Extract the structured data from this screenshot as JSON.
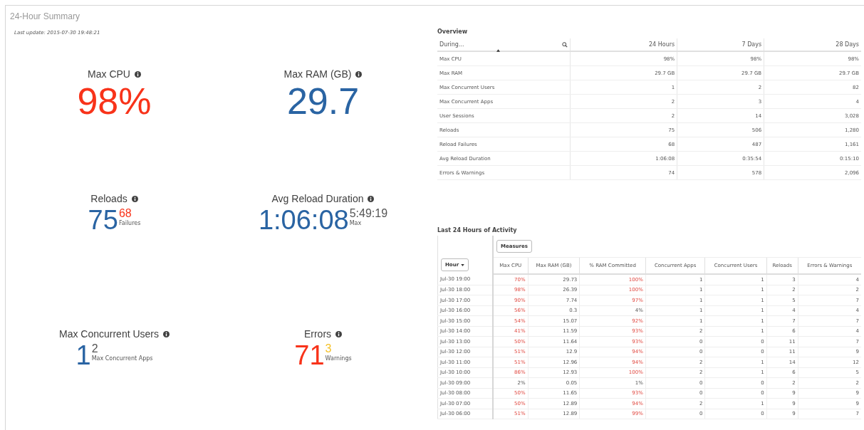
{
  "title": "24-Hour Summary",
  "last_update": "Last update: 2015-07-30 19:48:21",
  "kpis": [
    {
      "label": "Max CPU",
      "value": "98%",
      "color": "#f8331a"
    },
    {
      "label": "Max RAM (GB)",
      "value": "29.7",
      "color": "#2a64a3"
    },
    {
      "label": "Reloads",
      "value": "75",
      "color": "#2a64a3",
      "sub": {
        "value": "68",
        "label": "Failures",
        "color": "#f8331a"
      }
    },
    {
      "label": "Avg Reload Duration",
      "value": "1:06:08",
      "color": "#2a64a3",
      "sub": {
        "value": "5:49:19",
        "label": "Max",
        "color": "#555555"
      }
    },
    {
      "label": "Max Concurrent Users",
      "value": "1",
      "color": "#2a64a3",
      "sub": {
        "value": "2",
        "label": "Max Concurrent Apps",
        "color": "#555555"
      }
    },
    {
      "label": "Errors",
      "value": "71",
      "color": "#f8331a",
      "sub": {
        "value": "3",
        "label": "Warnings",
        "color": "#f5c22a"
      }
    }
  ],
  "overview": {
    "title": "Overview",
    "columns": [
      "During...",
      "24 Hours",
      "7 Days",
      "28 Days"
    ],
    "rows": [
      [
        "Max CPU",
        "98%",
        "98%",
        "98%"
      ],
      [
        "Max RAM",
        "29.7 GB",
        "29.7 GB",
        "29.7 GB"
      ],
      [
        "Max Concurrent Users",
        "1",
        "2",
        "82"
      ],
      [
        "Max Concurrent Apps",
        "2",
        "3",
        "4"
      ],
      [
        "User Sessions",
        "2",
        "14",
        "3,028"
      ],
      [
        "Reloads",
        "75",
        "506",
        "1,280"
      ],
      [
        "Reload Failures",
        "68",
        "487",
        "1,161"
      ],
      [
        "Avg Reload Duration",
        "1:06:08",
        "0:35:54",
        "0:15:10"
      ],
      [
        "Errors & Warnings",
        "74",
        "578",
        "2,096"
      ]
    ]
  },
  "activity": {
    "title": "Last 24 Hours of Activity",
    "dimension_button": "Hour",
    "measures_button": "Measures",
    "columns": [
      "Max CPU",
      "Max RAM (GB)",
      "% RAM Committed",
      "Concurrent Apps",
      "Concurrent Users",
      "Reloads",
      "Errors & Warnings"
    ],
    "rows": [
      {
        "hour": "Jul-30 19:00",
        "values": [
          "70%",
          "29.73",
          "100%",
          "1",
          "1",
          "3",
          "4"
        ],
        "flagged": [
          true,
          false,
          true,
          false,
          false,
          false,
          false
        ]
      },
      {
        "hour": "Jul-30 18:00",
        "values": [
          "98%",
          "26.39",
          "100%",
          "1",
          "1",
          "2",
          "2"
        ],
        "flagged": [
          true,
          false,
          true,
          false,
          false,
          false,
          false
        ]
      },
      {
        "hour": "Jul-30 17:00",
        "values": [
          "90%",
          "7.74",
          "97%",
          "1",
          "1",
          "5",
          "7"
        ],
        "flagged": [
          true,
          false,
          true,
          false,
          false,
          false,
          false
        ]
      },
      {
        "hour": "Jul-30 16:00",
        "values": [
          "56%",
          "0.3",
          "4%",
          "1",
          "1",
          "4",
          "4"
        ],
        "flagged": [
          true,
          false,
          false,
          false,
          false,
          false,
          false
        ]
      },
      {
        "hour": "Jul-30 15:00",
        "values": [
          "54%",
          "15.07",
          "92%",
          "1",
          "1",
          "7",
          "7"
        ],
        "flagged": [
          true,
          false,
          true,
          false,
          false,
          false,
          false
        ]
      },
      {
        "hour": "Jul-30 14:00",
        "values": [
          "41%",
          "11.59",
          "93%",
          "2",
          "1",
          "6",
          "4"
        ],
        "flagged": [
          true,
          false,
          true,
          false,
          false,
          false,
          false
        ]
      },
      {
        "hour": "Jul-30 13:00",
        "values": [
          "50%",
          "11.64",
          "93%",
          "0",
          "0",
          "11",
          "7"
        ],
        "flagged": [
          true,
          false,
          true,
          false,
          false,
          false,
          false
        ]
      },
      {
        "hour": "Jul-30 12:00",
        "values": [
          "51%",
          "12.9",
          "94%",
          "0",
          "0",
          "11",
          "9"
        ],
        "flagged": [
          true,
          false,
          true,
          false,
          false,
          false,
          false
        ]
      },
      {
        "hour": "Jul-30 11:00",
        "values": [
          "51%",
          "12.96",
          "94%",
          "2",
          "1",
          "14",
          "12"
        ],
        "flagged": [
          true,
          false,
          true,
          false,
          false,
          false,
          false
        ]
      },
      {
        "hour": "Jul-30 10:00",
        "values": [
          "86%",
          "12.93",
          "100%",
          "2",
          "1",
          "6",
          "5"
        ],
        "flagged": [
          true,
          false,
          true,
          false,
          false,
          false,
          false
        ]
      },
      {
        "hour": "Jul-30 09:00",
        "values": [
          "2%",
          "0.05",
          "1%",
          "0",
          "0",
          "2",
          "2"
        ],
        "flagged": [
          false,
          false,
          false,
          false,
          false,
          false,
          false
        ]
      },
      {
        "hour": "Jul-30 08:00",
        "values": [
          "50%",
          "11.65",
          "93%",
          "0",
          "0",
          "9",
          "9"
        ],
        "flagged": [
          true,
          false,
          true,
          false,
          false,
          false,
          false
        ]
      },
      {
        "hour": "Jul-30 07:00",
        "values": [
          "50%",
          "12.89",
          "94%",
          "2",
          "1",
          "9",
          "9"
        ],
        "flagged": [
          true,
          false,
          true,
          false,
          false,
          false,
          false
        ]
      },
      {
        "hour": "Jul-30 06:00",
        "values": [
          "51%",
          "12.89",
          "99%",
          "0",
          "0",
          "9",
          "7"
        ],
        "flagged": [
          true,
          false,
          true,
          false,
          false,
          false,
          false
        ]
      }
    ]
  }
}
